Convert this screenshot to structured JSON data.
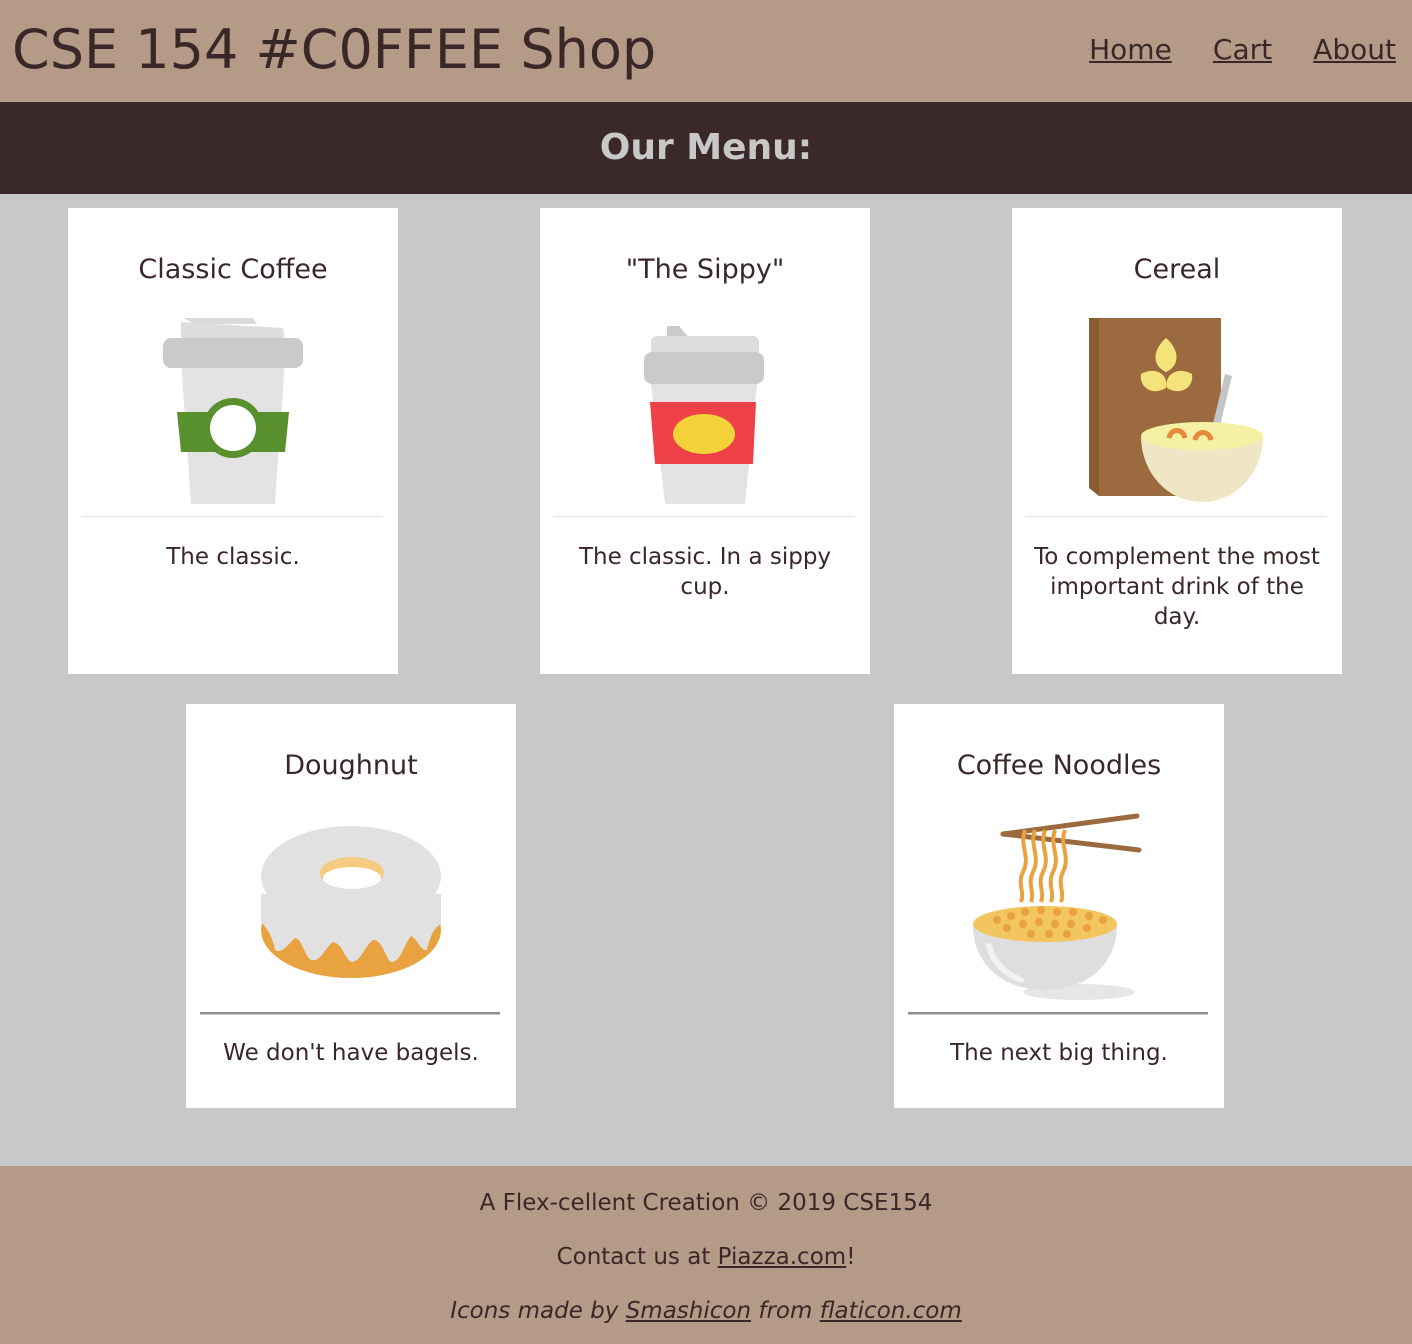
{
  "header": {
    "title": "CSE 154 #C0FFEE Shop",
    "nav": [
      "Home",
      "Cart",
      "About"
    ]
  },
  "banner": {
    "title": "Our Menu:"
  },
  "menu": [
    {
      "name": "Classic Coffee",
      "description": "The classic.",
      "icon": "coffee-cup-icon"
    },
    {
      "name": "\"The Sippy\"",
      "description": "The classic. In a sippy cup.",
      "icon": "sippy-cup-icon"
    },
    {
      "name": "Cereal",
      "description": "To complement the most important drink of the day.",
      "icon": "cereal-bowl-icon"
    },
    {
      "name": "Doughnut",
      "description": "We don't have bagels.",
      "icon": "doughnut-icon"
    },
    {
      "name": "Coffee Noodles",
      "description": "The next big thing.",
      "icon": "noodle-bowl-icon"
    }
  ],
  "footer": {
    "creation": "A Flex-cellent Creation © 2019 CSE154",
    "contact_prefix": "Contact us at ",
    "contact_link": "Piazza.com",
    "contact_suffix": "!",
    "credits_prefix": "Icons made by ",
    "credits_author": "Smashicon",
    "credits_middle": " from ",
    "credits_site": "flaticon.com"
  },
  "colors": {
    "header_bg": "#b49a87",
    "banner_bg": "#3b2828",
    "page_bg": "#c8c8c8",
    "text": "#3a2828"
  }
}
